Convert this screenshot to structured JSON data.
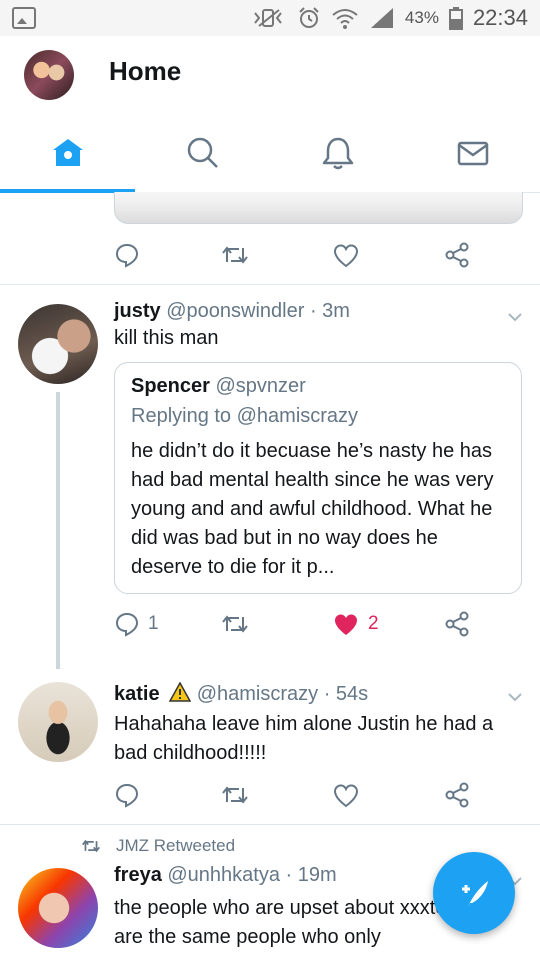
{
  "status_bar": {
    "battery_percent": "43%",
    "time": "22:34"
  },
  "header": {
    "title": "Home"
  },
  "tabs": [
    {
      "name": "home",
      "icon": "home-icon",
      "active": true
    },
    {
      "name": "search",
      "icon": "search-icon",
      "active": false
    },
    {
      "name": "notifications",
      "icon": "bell-icon",
      "active": false
    },
    {
      "name": "messages",
      "icon": "mail-icon",
      "active": false
    }
  ],
  "tweets": [
    {
      "name": "justy",
      "handle": "@poonswindler",
      "time": "· 3m",
      "text": "kill this man",
      "quote": {
        "name": "Spencer",
        "handle": "@spvnzer",
        "reply_label": "Replying to @hamiscrazy",
        "text": "he didn’t do it becuase he’s nasty he has had bad mental health since he was very young and and awful childhood. What he did was bad but in no way does he deserve to die for it p..."
      },
      "reply_count": "1",
      "like_count": "2",
      "liked": true
    },
    {
      "name": "katie",
      "handle": "@hamiscrazy",
      "time": "· 54s",
      "text": "Hahahaha leave him alone Justin he had a bad childhood!!!!!"
    },
    {
      "retweet_label": "JMZ Retweeted",
      "name": "freya",
      "handle": "@unhhkatya",
      "time": "· 19m",
      "text": "the people who are upset about xxxtentacle are the same people who only"
    }
  ],
  "colors": {
    "accent": "#1da1f2",
    "like": "#e0245e",
    "muted": "#657786"
  }
}
